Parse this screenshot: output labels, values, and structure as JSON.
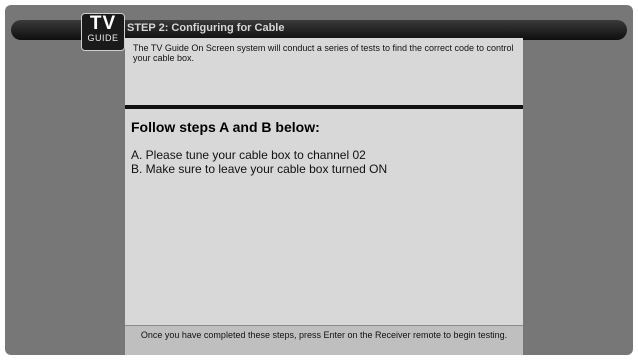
{
  "logo": {
    "line1": "TV",
    "line2": "GUIDE"
  },
  "header": {
    "title": "STEP 2: Configuring for Cable"
  },
  "intro": "The TV Guide On Screen system will conduct a series of tests to find the correct code to control your cable box.",
  "section": {
    "heading": "Follow steps A and B below:",
    "steps": [
      "A.  Please tune your cable box to channel 02",
      "B.  Make sure to leave your cable box turned ON"
    ]
  },
  "footer": "Once you have completed these steps, press Enter on the Receiver remote to begin testing."
}
